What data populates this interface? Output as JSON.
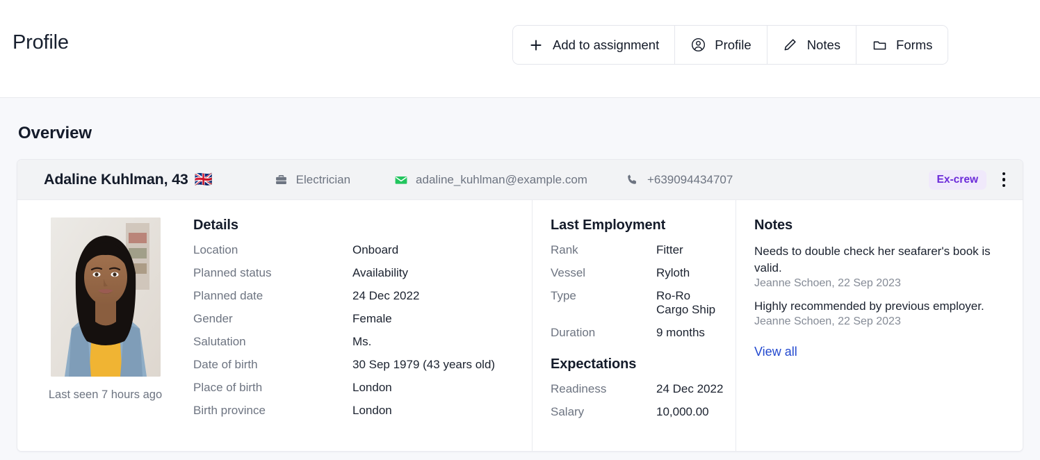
{
  "header": {
    "title": "Profile",
    "actions": [
      {
        "label": "Add to assignment",
        "icon": "plus-icon"
      },
      {
        "label": "Profile",
        "icon": "user-circle-icon"
      },
      {
        "label": "Notes",
        "icon": "pencil-icon"
      },
      {
        "label": "Forms",
        "icon": "folder-icon"
      }
    ]
  },
  "overview": {
    "section_title": "Overview",
    "person": {
      "name_age": "Adaline Kuhlman, 43",
      "flag": "🇬🇧",
      "rank": "Electrician",
      "email": "adaline_kuhlman@example.com",
      "phone": "+639094434707",
      "badge": "Ex-crew",
      "badge_color": "#6c2bd9",
      "badge_bg": "#f0e9fb",
      "last_seen": "Last seen 7 hours ago"
    },
    "details": {
      "title": "Details",
      "rows": [
        {
          "label": "Location",
          "value": "Onboard"
        },
        {
          "label": "Planned status",
          "value": "Availability"
        },
        {
          "label": "Planned date",
          "value": "24 Dec 2022"
        },
        {
          "label": "Gender",
          "value": "Female"
        },
        {
          "label": "Salutation",
          "value": "Ms."
        },
        {
          "label": "Date of birth",
          "value": "30 Sep 1979 (43 years old)"
        },
        {
          "label": "Place of birth",
          "value": "London"
        },
        {
          "label": "Birth province",
          "value": "London"
        }
      ]
    },
    "last_employment": {
      "title": "Last Employment",
      "rows": [
        {
          "label": "Rank",
          "value": "Fitter"
        },
        {
          "label": "Vessel",
          "value": "Ryloth"
        },
        {
          "label": "Type",
          "value": "Ro-Ro Cargo Ship"
        },
        {
          "label": "Duration",
          "value": "9 months"
        }
      ]
    },
    "expectations": {
      "title": "Expectations",
      "rows": [
        {
          "label": "Readiness",
          "value": "24 Dec 2022"
        },
        {
          "label": "Salary",
          "value": "10,000.00"
        }
      ]
    },
    "notes": {
      "title": "Notes",
      "items": [
        {
          "text": "Needs to double check her seafarer's book is valid.",
          "meta": "Jeanne Schoen, 22 Sep 2023"
        },
        {
          "text": "Highly recommended by previous employer.",
          "meta": "Jeanne Schoen, 22 Sep 2023"
        }
      ],
      "view_all": "View all",
      "link_color": "#2349cf"
    }
  }
}
